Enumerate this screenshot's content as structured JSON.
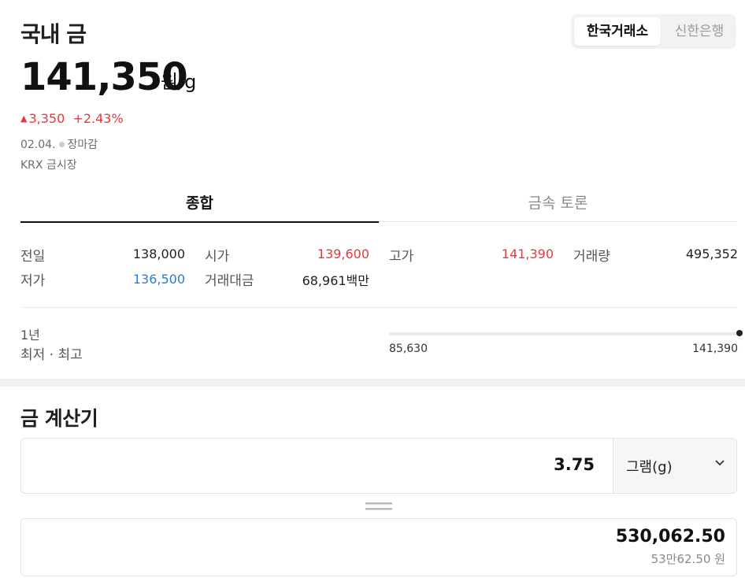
{
  "header": {
    "title": "국내 금",
    "toggle": {
      "active": "한국거래소",
      "inactive": "신한은행"
    }
  },
  "quote": {
    "price": "141,350",
    "unit": "원/g",
    "change_arrow": "▲",
    "change_abs": "3,350",
    "change_pct": "+2.43%",
    "date": "02.04.",
    "status": "장마감",
    "market": "KRX 금시장"
  },
  "tabs": [
    {
      "label": "종합",
      "active": true
    },
    {
      "label": "금속 토론",
      "active": false
    }
  ],
  "stats": {
    "prev_close": {
      "label": "전일",
      "value": "138,000"
    },
    "open": {
      "label": "시가",
      "value": "139,600"
    },
    "high": {
      "label": "고가",
      "value": "141,390"
    },
    "volume": {
      "label": "거래량",
      "value": "495,352"
    },
    "low": {
      "label": "저가",
      "value": "136,500"
    },
    "turnover": {
      "label": "거래대금",
      "value": "68,961백만"
    }
  },
  "range": {
    "period": "1년",
    "label": "최저 · 최고",
    "min": "85,630",
    "max": "141,390",
    "current_fraction": 1.0
  },
  "calculator": {
    "title": "금 계산기",
    "quantity": "3.75",
    "unit": "그램(g)",
    "result": "530,062.50",
    "result_korean": "53만62.50 원"
  },
  "colors": {
    "up": "#e0393e",
    "down": "#2b7bd6",
    "text": "#1f1f1f",
    "muted": "#6c6c6c"
  }
}
